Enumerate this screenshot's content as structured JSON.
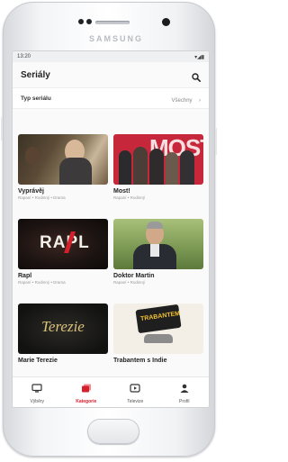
{
  "device": {
    "brand": "SAMSUNG"
  },
  "status_bar": {
    "time": "13:20",
    "icons": "▾◢▮"
  },
  "app_bar": {
    "title": "Seriály",
    "search_icon": "search-icon"
  },
  "filter": {
    "label": "Typ seriálu",
    "value": "Všechny",
    "chevron": "›"
  },
  "series": [
    {
      "title": "Vyprávěj",
      "subtitle": "Rapaní • Rodinný • Drama"
    },
    {
      "title": "Most!",
      "subtitle": "Rapaní • Rodinný"
    },
    {
      "title": "Rapl",
      "subtitle": "Rapaní • Rodinný • Drama"
    },
    {
      "title": "Doktor Martin",
      "subtitle": "Rapaní • Rodinný"
    },
    {
      "title": "Marie Terezie",
      "subtitle": ""
    },
    {
      "title": "Trabantem s Indie",
      "subtitle": ""
    }
  ],
  "posters": {
    "most": "MOST",
    "rapl": "RAPL",
    "terezie": "Terezie",
    "trabantem": "TRABANTEM"
  },
  "bottom_nav": [
    {
      "label": "Výběry",
      "icon": "tv-icon"
    },
    {
      "label": "Kategorie",
      "icon": "categories-icon",
      "active": true
    },
    {
      "label": "Televize",
      "icon": "play-icon"
    },
    {
      "label": "Profil",
      "icon": "profile-icon"
    }
  ],
  "colors": {
    "accent": "#d3202b"
  }
}
